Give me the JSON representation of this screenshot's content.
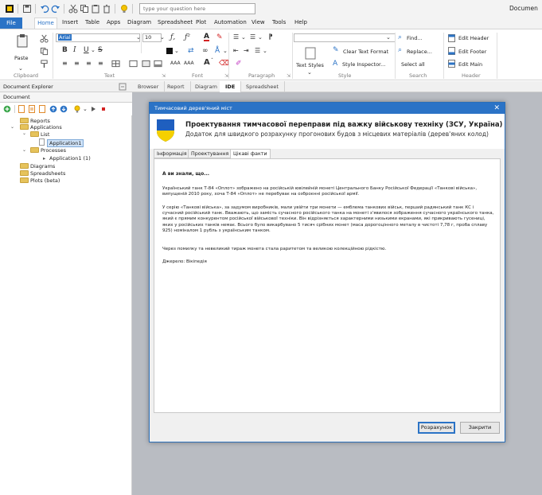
{
  "titlebar": {
    "search_placeholder": "type your question here",
    "doc_title": "Documen"
  },
  "menu": {
    "tabs": [
      "File",
      "Home",
      "Insert",
      "Table",
      "Apps",
      "Diagram",
      "Spreadsheet",
      "Plot",
      "Automation",
      "View",
      "Tools",
      "Help"
    ]
  },
  "ribbon": {
    "paste_label": "Paste",
    "font_name": "Arial",
    "font_size": "10",
    "clear_text_format": "Clear Text Format",
    "text_styles": "Text Styles",
    "style_inspector": "Style Inspector...",
    "find": "Find...",
    "replace": "Replace...",
    "select_all": "Select all",
    "edit_header": "Edit Header",
    "edit_footer": "Edit Footer",
    "edit_main": "Edit Main",
    "groups": {
      "clipboard": "Clipboard",
      "text": "Text",
      "font": "Font",
      "paragraph": "Paragraph",
      "style": "Style",
      "search": "Search",
      "header": "Header"
    }
  },
  "explorer": {
    "title": "Document Explorer",
    "sub_tab": "Document",
    "tree": {
      "reports": "Reports",
      "applications": "Applications",
      "list": "List",
      "application1": "Application1",
      "processes": "Processes",
      "application1_proc": "Application1 (1)",
      "diagrams": "Diagrams",
      "spreadsheets": "Spreadsheets",
      "plots": "Plots (beta)"
    }
  },
  "center_tabs": [
    "Browser",
    "Report",
    "Diagram",
    "IDE",
    "Spreadsheet"
  ],
  "dialog": {
    "window_title": "Тимчасовий дерев'яний міст",
    "title": "Проектування тимчасової переправи під важку військову техніку (ЗСУ, Україна)",
    "subtitle": "Додаток для швидкого розрахунку прогонових будов з місцевих матеріалів (дерев'яних колод)",
    "tabs": [
      "Інформація",
      "Проектування",
      "Цікаві факти"
    ],
    "panel": {
      "heading": "А ви знали, що...",
      "p1": "Український танк Т-84 «Оплот» зображено на російській ювілейній монеті Центрального Банку Російської Федерації «Танкові війська», випущеній 2010 року, хоча Т-84 «Оплот» не перебуває на озброєнні російської армії.",
      "p2": "У серію «Танкові війська», за задумом виробників, мали увійти три монети — емблема танкових військ, перший радянський танк КС і сучасний російський танк. Вважають, що замість сучасного російського танка на монеті з'явилося зображення сучасного українського танка, який є прямим конкурентом російської військової техніки. Він відрізняється характерними низькими екранами, які прикривають гусениці, яких у російських танків немає. Всього було викарбувано 5 тисяч срібних монет (маса дорогоцінного металу в чистоті 7,78 г, проба сплаву 925) номіналом 1 рубль з українським танком.",
      "p3": "Через помилку та невеликий тираж монета стала раритетом та великою колекційною рідкістю.",
      "p4": "Джерело: Вікіпедія"
    },
    "buttons": {
      "calculate": "Розрахунок",
      "close": "Закрити"
    }
  },
  "colors": {
    "accent": "#2b73c6",
    "shield_blue": "#1f5fbf",
    "shield_yellow": "#f5d000"
  }
}
